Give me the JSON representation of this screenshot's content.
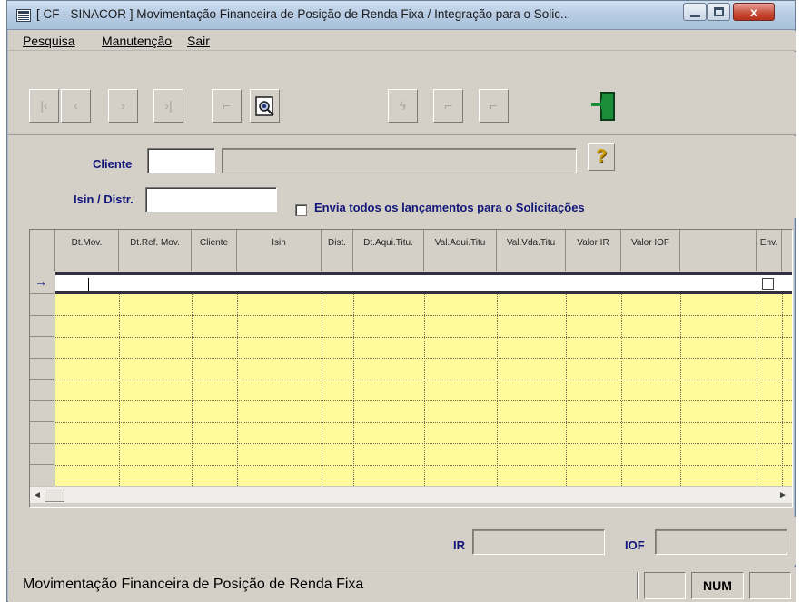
{
  "window": {
    "title": "[ CF - SINACOR ] Movimentação Financeira de Posição de Renda Fixa / Integração para o Solic...",
    "close_label": "x"
  },
  "menu": [
    {
      "label": "Pesquisa"
    },
    {
      "label": "Manutenção"
    },
    {
      "label": "Sair"
    }
  ],
  "toolbar": {
    "buttons": [
      {
        "icon": "first-record-icon",
        "glyph": "|‹",
        "enabled": false
      },
      {
        "icon": "previous-record-icon",
        "glyph": "‹",
        "enabled": false
      },
      {
        "icon": "next-record-icon",
        "glyph": "›",
        "enabled": false
      },
      {
        "icon": "last-record-icon",
        "glyph": "›|",
        "enabled": false
      },
      {
        "icon": "new-record-icon",
        "glyph": "⌐",
        "enabled": false
      },
      {
        "icon": "search-binoculars-icon",
        "glyph": "",
        "enabled": true
      },
      {
        "icon": "lightning-icon",
        "glyph": "ϟ",
        "enabled": false
      },
      {
        "icon": "cancel-icon",
        "glyph": "⌐",
        "enabled": false
      },
      {
        "icon": "confirm-icon",
        "glyph": "⌐",
        "enabled": false
      }
    ],
    "exit_icon": "exit-door-icon"
  },
  "filters": {
    "cliente_label": "Cliente",
    "cliente_code": "",
    "cliente_name": "",
    "isin_label": "Isin / Distr.",
    "isin_value": "",
    "envia_todos_label": "Envia todos os lançamentos para o Solicitações",
    "envia_todos_checked": false
  },
  "grid": {
    "columns": [
      {
        "label": "Dt.Mov."
      },
      {
        "label": "Dt.Ref. Mov."
      },
      {
        "label": "Cliente"
      },
      {
        "label": "Isin"
      },
      {
        "label": "Dist."
      },
      {
        "label": "Dt.Aqui.Titu."
      },
      {
        "label": "Val.Aqui.Titu"
      },
      {
        "label": "Val.Vda.Titu"
      },
      {
        "label": "Valor IR"
      },
      {
        "label": "Valor IOF"
      },
      {
        "label": ""
      },
      {
        "label": "Env."
      }
    ],
    "row_count": 10,
    "current_row_indicator": "→",
    "scroll_left": "◄",
    "scroll_right": "►"
  },
  "totals": {
    "ir_label": "IR",
    "ir_value": "",
    "iof_label": "IOF",
    "iof_value": ""
  },
  "statusbar": {
    "text": "Movimentação Financeira de Posição de Renda Fixa",
    "num_label": "NUM"
  }
}
